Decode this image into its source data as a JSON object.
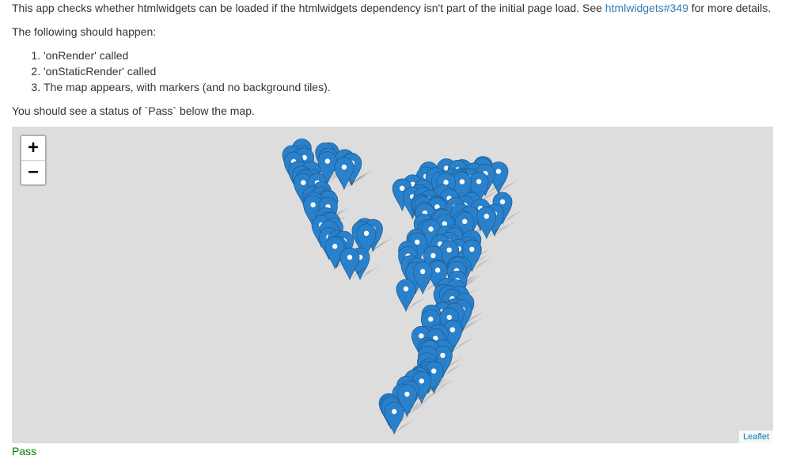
{
  "intro": {
    "text_before": "This app checks whether htmlwidgets can be loaded if the htmlwidgets dependency isn't part of the initial page load. See ",
    "link_text": "htmlwidgets#349",
    "text_after": " for more details."
  },
  "expect_heading": "The following should happen:",
  "steps": [
    "'onRender' called",
    "'onStaticRender' called",
    "The map appears, with markers (and no background tiles)."
  ],
  "status_note": "You should see a status of `Pass` below the map.",
  "map": {
    "zoom_in": "+",
    "zoom_out": "−",
    "attribution": "Leaflet",
    "marker_color": "#2a81cb"
  },
  "status": "Pass"
}
